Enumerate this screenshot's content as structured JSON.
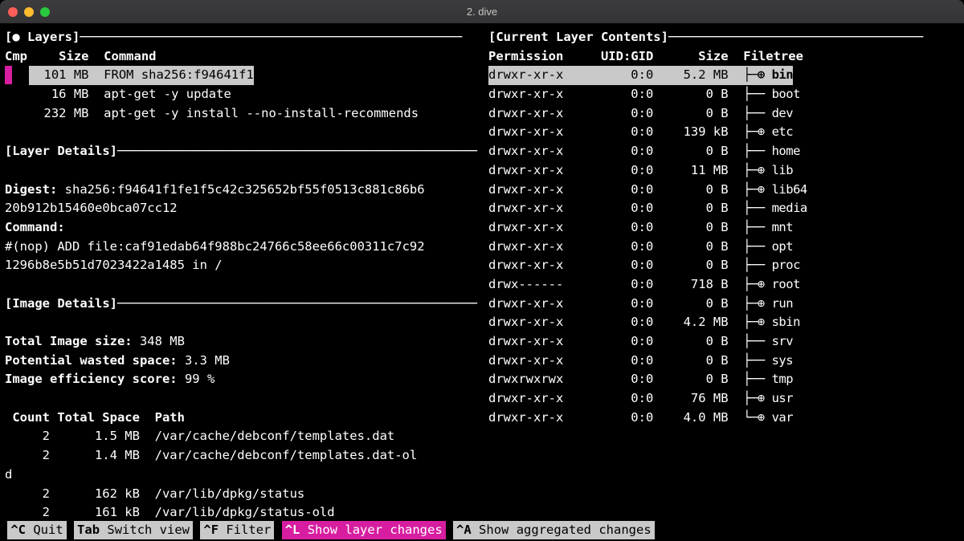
{
  "window": {
    "title": "2. dive"
  },
  "panels": {
    "layers_title": "[● Layers]",
    "contents_title": "[Current Layer Contents]",
    "details_title": "[Layer Details]",
    "image_details_title": "[Image Details]"
  },
  "layers": {
    "headers": {
      "cmp": "Cmp",
      "size": "Size",
      "command": "Command"
    },
    "rows": [
      {
        "size": "101 MB",
        "command": "FROM sha256:f94641f1",
        "selected": true
      },
      {
        "size": "16 MB",
        "command": "apt-get -y update",
        "selected": false
      },
      {
        "size": "232 MB",
        "command": "apt-get -y install --no-install-recommends",
        "selected": false
      }
    ]
  },
  "layer_details": {
    "digest_label": "Digest:",
    "digest_value": "sha256:f94641f1fe1f5c42c325652bf55f0513c881c86b620b912b15460e0bca07cc12",
    "digest_line1": "sha256:f94641f1fe1f5c42c325652bf55f0513c881c86b6",
    "digest_line2": "20b912b15460e0bca07cc12",
    "command_label": "Command:",
    "command_line1": "#(nop) ADD file:caf91edab64f988bc24766c58ee66c00311c7c92",
    "command_line2": "1296b8e5b51d7023422a1485 in /"
  },
  "image_details": {
    "total_label": "Total Image size:",
    "total_value": "348 MB",
    "wasted_label": "Potential wasted space:",
    "wasted_value": "3.3 MB",
    "eff_label": "Image efficiency score:",
    "eff_value": "99 %"
  },
  "wasted": {
    "headers": {
      "count": "Count",
      "space": "Total Space",
      "path": "Path"
    },
    "rows": [
      {
        "count": "2",
        "space": "1.5 MB",
        "path": "/var/cache/debconf/templates.dat"
      },
      {
        "count": "2",
        "space": "1.4 MB",
        "path": "/var/cache/debconf/templates.dat-ol"
      },
      {
        "overflow": "d"
      },
      {
        "count": "2",
        "space": "162 kB",
        "path": "/var/lib/dpkg/status"
      },
      {
        "count": "2",
        "space": "161 kB",
        "path": "/var/lib/dpkg/status-old"
      }
    ]
  },
  "filetree": {
    "headers": {
      "perm": "Permission",
      "uid": "UID:GID",
      "size": "Size",
      "tree": "Filetree"
    },
    "rows": [
      {
        "perm": "drwxr-xr-x",
        "uid": "0:0",
        "size": "5.2 MB",
        "tree": "├─⊕ bin",
        "sel": true
      },
      {
        "perm": "drwxr-xr-x",
        "uid": "0:0",
        "size": "0 B",
        "tree": "├── boot"
      },
      {
        "perm": "drwxr-xr-x",
        "uid": "0:0",
        "size": "0 B",
        "tree": "├── dev"
      },
      {
        "perm": "drwxr-xr-x",
        "uid": "0:0",
        "size": "139 kB",
        "tree": "├─⊕ etc"
      },
      {
        "perm": "drwxr-xr-x",
        "uid": "0:0",
        "size": "0 B",
        "tree": "├── home"
      },
      {
        "perm": "drwxr-xr-x",
        "uid": "0:0",
        "size": "11 MB",
        "tree": "├─⊕ lib"
      },
      {
        "perm": "drwxr-xr-x",
        "uid": "0:0",
        "size": "0 B",
        "tree": "├─⊕ lib64"
      },
      {
        "perm": "drwxr-xr-x",
        "uid": "0:0",
        "size": "0 B",
        "tree": "├── media"
      },
      {
        "perm": "drwxr-xr-x",
        "uid": "0:0",
        "size": "0 B",
        "tree": "├── mnt"
      },
      {
        "perm": "drwxr-xr-x",
        "uid": "0:0",
        "size": "0 B",
        "tree": "├── opt"
      },
      {
        "perm": "drwxr-xr-x",
        "uid": "0:0",
        "size": "0 B",
        "tree": "├── proc"
      },
      {
        "perm": "drwx------",
        "uid": "0:0",
        "size": "718 B",
        "tree": "├─⊕ root"
      },
      {
        "perm": "drwxr-xr-x",
        "uid": "0:0",
        "size": "0 B",
        "tree": "├─⊕ run"
      },
      {
        "perm": "drwxr-xr-x",
        "uid": "0:0",
        "size": "4.2 MB",
        "tree": "├─⊕ sbin"
      },
      {
        "perm": "drwxr-xr-x",
        "uid": "0:0",
        "size": "0 B",
        "tree": "├── srv"
      },
      {
        "perm": "drwxr-xr-x",
        "uid": "0:0",
        "size": "0 B",
        "tree": "├── sys"
      },
      {
        "perm": "drwxrwxrwx",
        "uid": "0:0",
        "size": "0 B",
        "tree": "├── tmp"
      },
      {
        "perm": "drwxr-xr-x",
        "uid": "0:0",
        "size": "76 MB",
        "tree": "├─⊕ usr"
      },
      {
        "perm": "drwxr-xr-x",
        "uid": "0:0",
        "size": "4.0 MB",
        "tree": "└─⊕ var"
      }
    ]
  },
  "statusbar": {
    "items": [
      {
        "key": "^C",
        "label": "Quit",
        "active": false
      },
      {
        "key": "Tab",
        "label": "Switch view",
        "active": false
      },
      {
        "key": "^F",
        "label": "Filter",
        "active": false
      },
      {
        "key": "^L",
        "label": "Show layer changes",
        "active": true
      },
      {
        "key": "^A",
        "label": "Show aggregated changes",
        "active": false
      }
    ]
  }
}
